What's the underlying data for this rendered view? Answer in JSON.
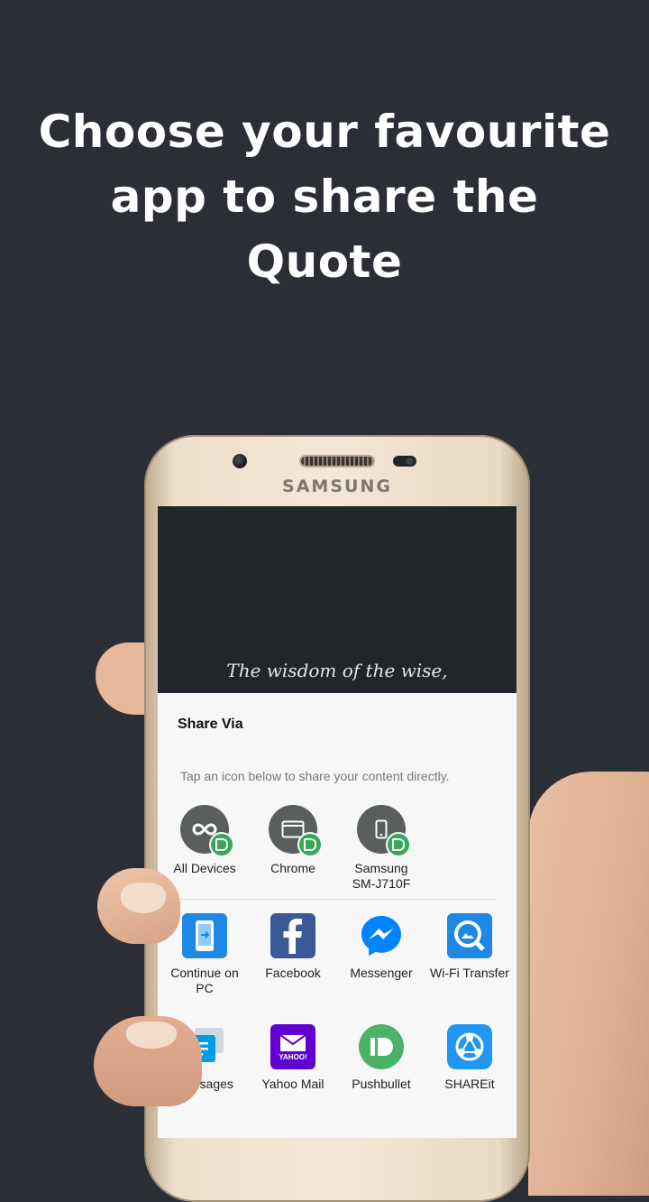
{
  "headline": {
    "line1": "Choose your favourite",
    "line2": "app to share the",
    "line3": "Quote"
  },
  "phone": {
    "brand": "SAMSUNG"
  },
  "screen": {
    "quote_text": "The wisdom of the wise,"
  },
  "share_sheet": {
    "title": "Share Via",
    "hint": "Tap an icon below to share your content directly.",
    "devices": [
      {
        "label": "All Devices",
        "icon": "infinity-icon"
      },
      {
        "label": "Chrome",
        "icon": "browser-window-icon"
      },
      {
        "label": "Samsung\nSM-J710F",
        "icon": "phone-icon"
      }
    ],
    "apps": [
      {
        "label": "Continue on PC",
        "icon": "continue-on-pc-icon",
        "color": "#1e88e5"
      },
      {
        "label": "Facebook",
        "icon": "facebook-icon",
        "color": "#3b5998"
      },
      {
        "label": "Messenger",
        "icon": "messenger-icon",
        "color": "#0084ff"
      },
      {
        "label": "Wi-Fi Transfer",
        "icon": "wifi-transfer-icon",
        "color": "#1e88e5"
      },
      {
        "label": "Messages",
        "icon": "messages-icon",
        "color": "#039be5"
      },
      {
        "label": "Yahoo Mail",
        "icon": "yahoo-mail-icon",
        "color": "#6001d2"
      },
      {
        "label": "Pushbullet",
        "icon": "pushbullet-icon",
        "color": "#4ab367"
      },
      {
        "label": "SHAREit",
        "icon": "shareit-icon",
        "color": "#2196f3"
      }
    ]
  }
}
